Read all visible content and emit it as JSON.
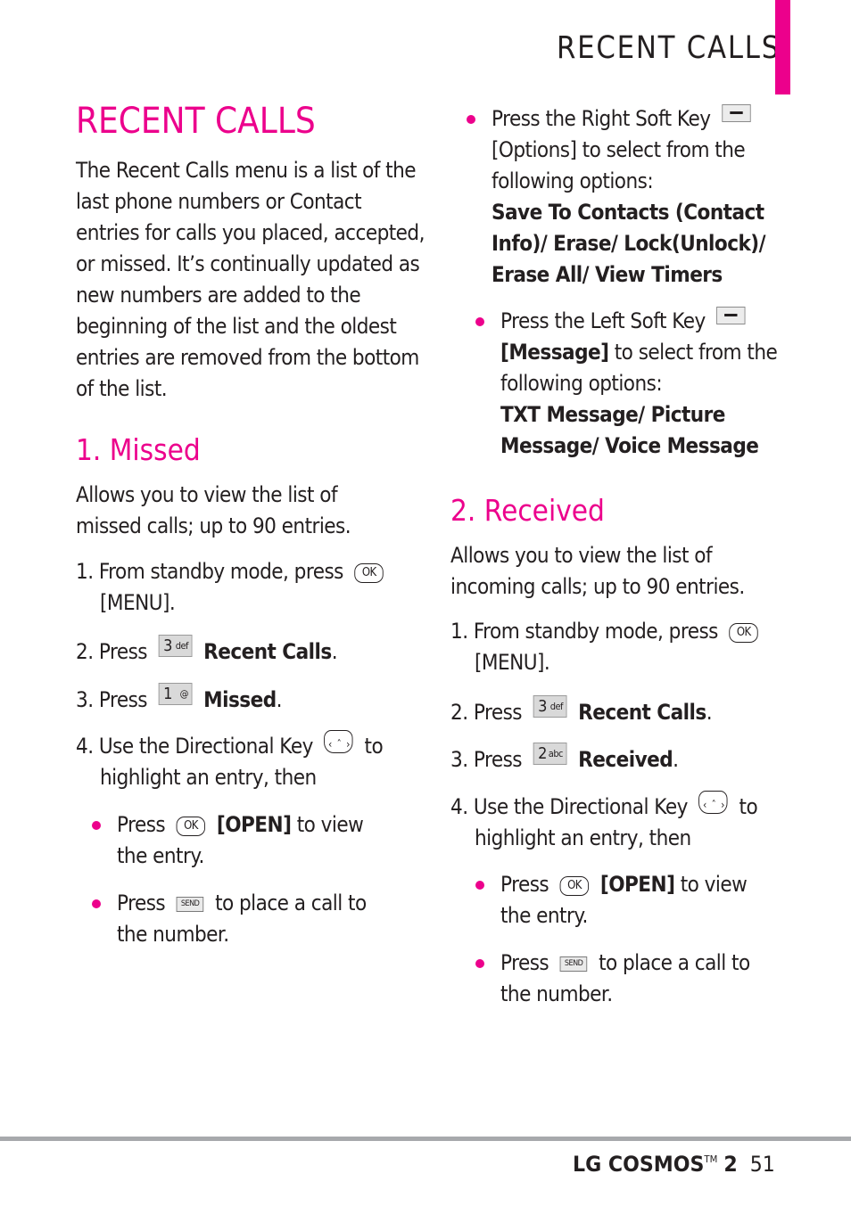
{
  "header": {
    "title": "RECENT CALLS",
    "accent_color": "#ec008c"
  },
  "left": {
    "title": "RECENT CALLS",
    "intro": [
      "The Recent Calls menu is a list of the",
      "last phone numbers or Contact",
      "entries for calls you placed, accepted,",
      "or missed. It’s continually updated as",
      "new numbers are added to the",
      "beginning of the list and the oldest",
      "entries are removed from the bottom",
      "of the list."
    ],
    "section1": {
      "heading": "1. Missed",
      "desc": [
        "Allows you to view the list of",
        "missed calls; up to 90 entries."
      ],
      "step1_a": "1. From standby mode, press",
      "step1_key": "OK",
      "step1_b_pre": "[",
      "step1_b_bold": "MENU",
      "step1_b_post": "].",
      "step2_pre": "2. Press",
      "step2_key_num": "3",
      "step2_key_letters": "def",
      "step2_bold": "Recent Calls",
      "step2_post": ".",
      "step3_pre": "3. Press",
      "step3_key_num": "1",
      "step3_key_letters": "@",
      "step3_bold": "Missed",
      "step3_post": ".",
      "step4_a": "4. Use the Directional Key",
      "step4_a_post": "to",
      "step4_b": "highlight an entry, then",
      "bullet1_pre": "Press",
      "bullet1_key": "OK",
      "bullet1_bold": "[OPEN]",
      "bullet1_post": "to  view",
      "bullet1_line2": "the entry.",
      "bullet2_pre": "Press",
      "bullet2_key": "SEND",
      "bullet2_post": "to place a call to",
      "bullet2_line2": "the number."
    }
  },
  "right": {
    "bullet_rsk_pre": "Press the Right Soft Key",
    "bullet_rsk_line2_pre": "[",
    "bullet_rsk_line2_bold": "Options",
    "bullet_rsk_line2_post": "] to select from the",
    "bullet_rsk_line3": "following options:",
    "rsk_options": [
      "Save To Contacts (Contact",
      "Info)/ Erase/ Lock(Unlock)/",
      "Erase All/ View Timers"
    ],
    "bullet_lsk_pre": "Press the Left Soft Key",
    "bullet_lsk_line2_bold": "[Message]",
    "bullet_lsk_line2_post": "to select from the",
    "bullet_lsk_line3": "following options:",
    "lsk_options": [
      "TXT Message/ Picture",
      "Message/ Voice Message"
    ],
    "section2": {
      "heading": "2. Received",
      "desc": [
        "Allows you to view the list of",
        "incoming calls; up to 90 entries."
      ],
      "step1_a": "1. From standby mode, press",
      "step1_key": "OK",
      "step1_b_pre": "[",
      "step1_b_bold": "MENU",
      "step1_b_post": "].",
      "step2_pre": "2. Press",
      "step2_key_num": "3",
      "step2_key_letters": "def",
      "step2_bold": "Recent Calls",
      "step2_post": ".",
      "step3_pre": "3. Press",
      "step3_key_num": "2",
      "step3_key_letters": "abc",
      "step3_bold": "Received",
      "step3_post": ".",
      "step4_a": "4. Use the Directional Key",
      "step4_a_post": "to",
      "step4_b": "highlight an entry, then",
      "bullet1_pre": "Press",
      "bullet1_key": "OK",
      "bullet1_bold": "[OPEN]",
      "bullet1_post": "to view",
      "bullet1_line2": "the entry.",
      "bullet2_pre": "Press",
      "bullet2_key": "SEND",
      "bullet2_post": "to place a call to",
      "bullet2_line2": "the number."
    }
  },
  "footer": {
    "brand": "LG COSMOS",
    "tm": "TM",
    "model": "2",
    "page_number": "51"
  }
}
